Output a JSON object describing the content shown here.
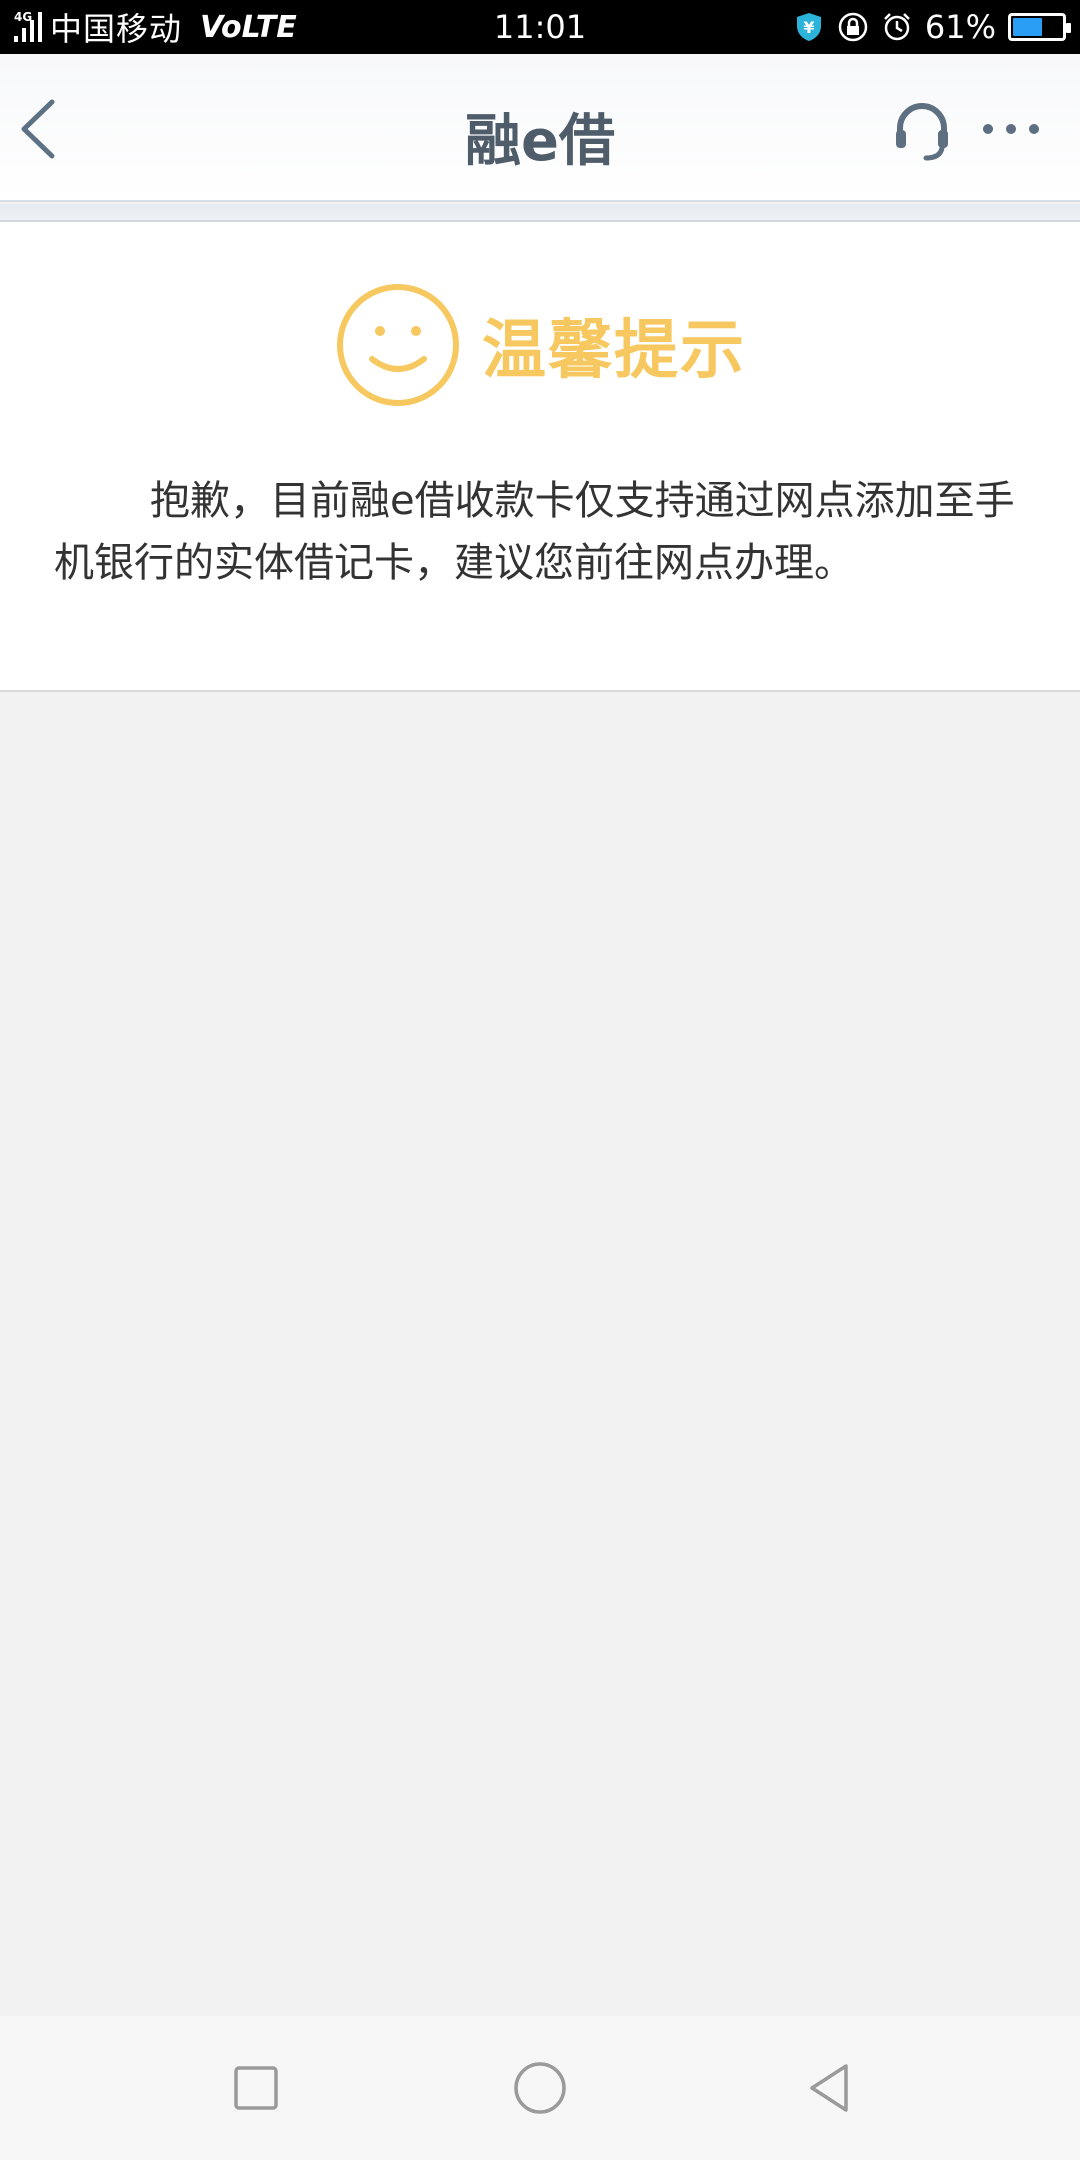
{
  "status_bar": {
    "network_gen": "4G",
    "carrier": "中国移动",
    "volte": "VoLTE",
    "time": "11:01",
    "battery_percent": "61%",
    "battery_level": 0.61,
    "battery_color": "#2a9df4"
  },
  "nav": {
    "title": "融e借",
    "back_icon": "chevron-left-icon",
    "service_icon": "headset-icon",
    "more_icon": "more-dots-icon"
  },
  "notice": {
    "title": "温馨提示",
    "title_color": "#f6c85f",
    "message": "抱歉，目前融e借收款卡仅支持通过网点添加至手机银行的实体借记卡，建议您前往网点办理。"
  },
  "system_nav": {
    "recent_icon": "square-icon",
    "home_icon": "circle-icon",
    "back_icon": "triangle-back-icon"
  }
}
